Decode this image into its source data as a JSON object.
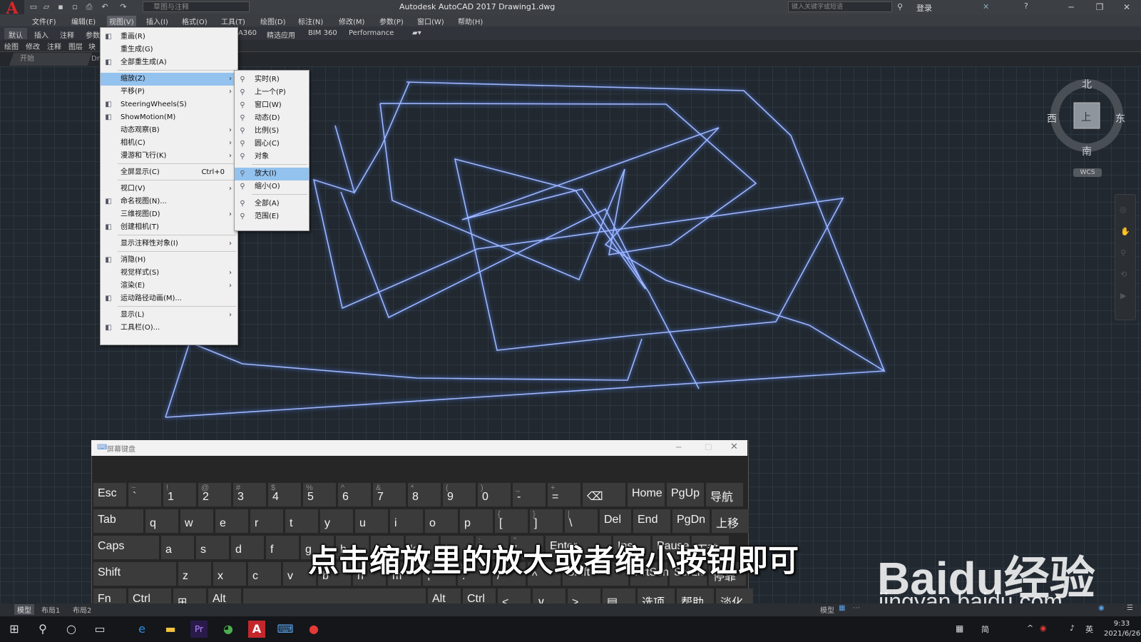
{
  "app": {
    "logo": "A",
    "workspace": "草图与注释",
    "title": "Autodesk AutoCAD 2017    Drawing1.dwg",
    "search_placeholder": "键入关键字或短语",
    "login": "登录"
  },
  "menubar": [
    "文件(F)",
    "编辑(E)",
    "视图(V)",
    "插入(I)",
    "格式(O)",
    "工具(T)",
    "绘图(D)",
    "标注(N)",
    "修改(M)",
    "参数(P)",
    "窗口(W)",
    "帮助(H)"
  ],
  "ribbon": {
    "tabs_left": [
      "默认",
      "插入",
      "注释",
      "参数"
    ],
    "tabs_right": [
      "A360",
      "精选应用",
      "BIM 360",
      "Performance"
    ],
    "panels": [
      "绘图",
      "修改",
      "注释",
      "图层",
      "块"
    ],
    "file_tab_start": "开始",
    "file_tab_drawing": "Dr"
  },
  "view_menu": {
    "items": [
      {
        "label": "重画(R)",
        "icon": "pencil-icon"
      },
      {
        "label": "重生成(G)"
      },
      {
        "label": "全部重生成(A)",
        "icon": "regen-icon"
      },
      {
        "label": "缩放(Z)",
        "submenu": true,
        "highlighted": true
      },
      {
        "label": "平移(P)",
        "submenu": true
      },
      {
        "label": "SteeringWheels(S)",
        "icon": "wheel-icon"
      },
      {
        "label": "ShowMotion(M)",
        "icon": "showmotion-icon"
      },
      {
        "label": "动态观察(B)",
        "submenu": true
      },
      {
        "label": "相机(C)",
        "submenu": true
      },
      {
        "label": "漫游和飞行(K)",
        "submenu": true
      },
      {
        "label": "全屏显示(C)",
        "shortcut": "Ctrl+0"
      },
      {
        "label": "视口(V)",
        "submenu": true
      },
      {
        "label": "命名视图(N)...",
        "icon": "named-view-icon"
      },
      {
        "label": "三维视图(D)",
        "submenu": true
      },
      {
        "label": "创建相机(T)",
        "icon": "camera-icon"
      },
      {
        "label": "显示注释性对象(I)",
        "submenu": true
      },
      {
        "label": "消隐(H)",
        "icon": "hide-icon"
      },
      {
        "label": "视觉样式(S)",
        "submenu": true
      },
      {
        "label": "渲染(E)",
        "submenu": true
      },
      {
        "label": "运动路径动画(M)...",
        "icon": "motion-path-icon"
      },
      {
        "label": "显示(L)",
        "submenu": true
      },
      {
        "label": "工具栏(O)...",
        "icon": "toolbar-icon"
      }
    ]
  },
  "zoom_menu": {
    "items": [
      {
        "label": "实时(R)"
      },
      {
        "label": "上一个(P)"
      },
      {
        "label": "窗口(W)"
      },
      {
        "label": "动态(D)"
      },
      {
        "label": "比例(S)"
      },
      {
        "label": "圆心(C)"
      },
      {
        "label": "对象"
      },
      {
        "label": "放大(I)",
        "highlighted": true
      },
      {
        "label": "缩小(O)"
      },
      {
        "label": "全部(A)"
      },
      {
        "label": "范围(E)"
      }
    ]
  },
  "viewcube": {
    "north": "北",
    "south": "南",
    "east": "东",
    "west": "西",
    "face": "上",
    "wcs": "WCS"
  },
  "keyboard": {
    "title": "屏幕键盘",
    "rows": [
      [
        [
          "Esc",
          ""
        ],
        [
          "`",
          "~"
        ],
        [
          "1",
          "!"
        ],
        [
          "2",
          "@"
        ],
        [
          "3",
          "#"
        ],
        [
          "4",
          "$"
        ],
        [
          "5",
          "%"
        ],
        [
          "6",
          "^"
        ],
        [
          "7",
          "&"
        ],
        [
          "8",
          "*"
        ],
        [
          "9",
          "("
        ],
        [
          "0",
          ")"
        ],
        [
          "-",
          "_"
        ],
        [
          "=",
          "+"
        ],
        [
          "⌫",
          ""
        ],
        [
          "Home",
          ""
        ],
        [
          "PgUp",
          ""
        ],
        [
          "导航",
          ""
        ]
      ],
      [
        [
          "Tab",
          ""
        ],
        [
          "q",
          ""
        ],
        [
          "w",
          ""
        ],
        [
          "e",
          ""
        ],
        [
          "r",
          ""
        ],
        [
          "t",
          ""
        ],
        [
          "y",
          ""
        ],
        [
          "u",
          ""
        ],
        [
          "i",
          ""
        ],
        [
          "o",
          ""
        ],
        [
          "p",
          ""
        ],
        [
          "[",
          "{"
        ],
        [
          "]",
          "}"
        ],
        [
          "\\",
          "|"
        ],
        [
          "Del",
          ""
        ],
        [
          "End",
          ""
        ],
        [
          "PgDn",
          ""
        ],
        [
          "上移",
          ""
        ]
      ],
      [
        [
          "Caps",
          ""
        ],
        [
          "a",
          ""
        ],
        [
          "s",
          ""
        ],
        [
          "d",
          ""
        ],
        [
          "f",
          ""
        ],
        [
          "g",
          ""
        ],
        [
          "h",
          ""
        ],
        [
          "j",
          ""
        ],
        [
          "k",
          ""
        ],
        [
          "l",
          ""
        ],
        [
          ";",
          ":"
        ],
        [
          "'",
          "\""
        ],
        [
          "Enter",
          ""
        ],
        [
          "Ins",
          ""
        ],
        [
          "Pause",
          ""
        ],
        [
          "下移",
          ""
        ]
      ],
      [
        [
          "Shift",
          ""
        ],
        [
          "z",
          ""
        ],
        [
          "x",
          ""
        ],
        [
          "c",
          ""
        ],
        [
          "v",
          ""
        ],
        [
          "b",
          ""
        ],
        [
          "n",
          ""
        ],
        [
          "m",
          ""
        ],
        [
          ",",
          "<"
        ],
        [
          ".",
          ">"
        ],
        [
          "/",
          "?"
        ],
        [
          "^",
          ""
        ],
        [
          "Shift",
          ""
        ],
        [
          "PrtScn",
          ""
        ],
        [
          "ScrLk",
          ""
        ],
        [
          "停靠",
          ""
        ]
      ],
      [
        [
          "Fn",
          ""
        ],
        [
          "Ctrl",
          ""
        ],
        [
          "⊞",
          ""
        ],
        [
          "Alt",
          ""
        ],
        [
          "",
          ""
        ],
        [
          "Alt",
          ""
        ],
        [
          "Ctrl",
          ""
        ],
        [
          "<",
          ""
        ],
        [
          "∨",
          ""
        ],
        [
          ">",
          ""
        ],
        [
          "▤",
          ""
        ],
        [
          "选项",
          ""
        ],
        [
          "帮助",
          ""
        ],
        [
          "淡化",
          ""
        ]
      ]
    ]
  },
  "subtitle": "点击缩放里的放大或者缩小按钮即可",
  "watermark": {
    "logo": "Baidu经验",
    "url": "jingyan.baidu.com"
  },
  "statusbar": {
    "tabs": [
      "模型",
      "布局1",
      "布局2"
    ],
    "model": "模型"
  },
  "taskbar": {
    "time": "9:33",
    "date": "2021/6/26",
    "ime": "英",
    "lang": "简"
  }
}
